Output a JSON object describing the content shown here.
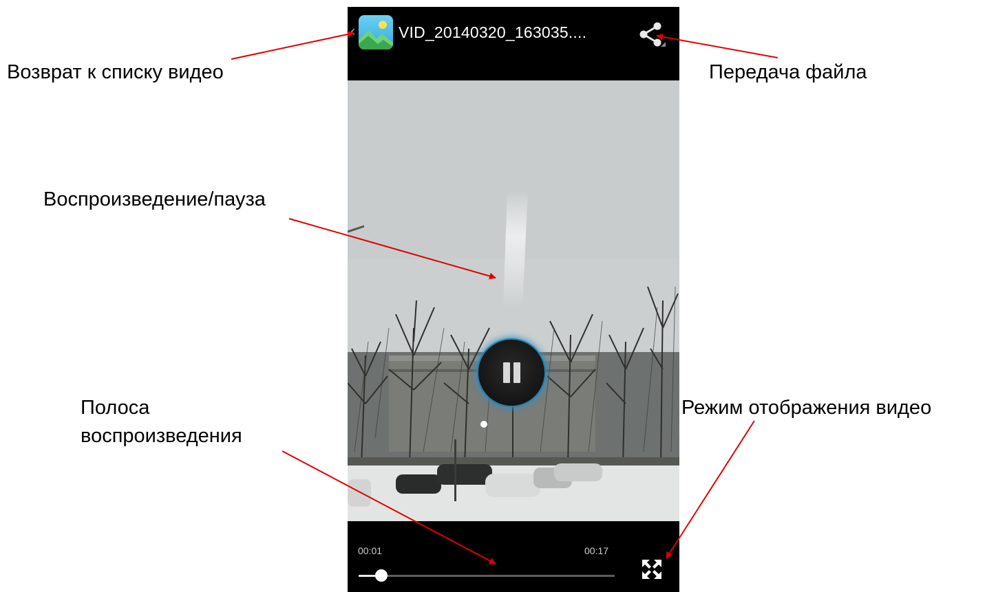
{
  "player": {
    "title": "VID_20140320_163035....",
    "back_icon": "chevron-left-icon",
    "app_icon": "gallery-app-icon",
    "share_icon": "share-icon",
    "play_state_icon": "pause-icon",
    "fullscreen_icon": "fullscreen-icon",
    "time_current": "00:01",
    "time_total": "00:17",
    "progress_fraction": 0.09
  },
  "annotations": {
    "back": "Возврат к списку видео",
    "share": "Передача файла",
    "play_pause": "Воспроизведение/пауза",
    "seekbar_line1": "Полоса",
    "seekbar_line2": "воспроизведения",
    "display_mode": "Режим отображения видео"
  },
  "colors": {
    "arrow": "#e00000",
    "player_bg": "#000000",
    "pause_glow": "#2f8fc4"
  }
}
